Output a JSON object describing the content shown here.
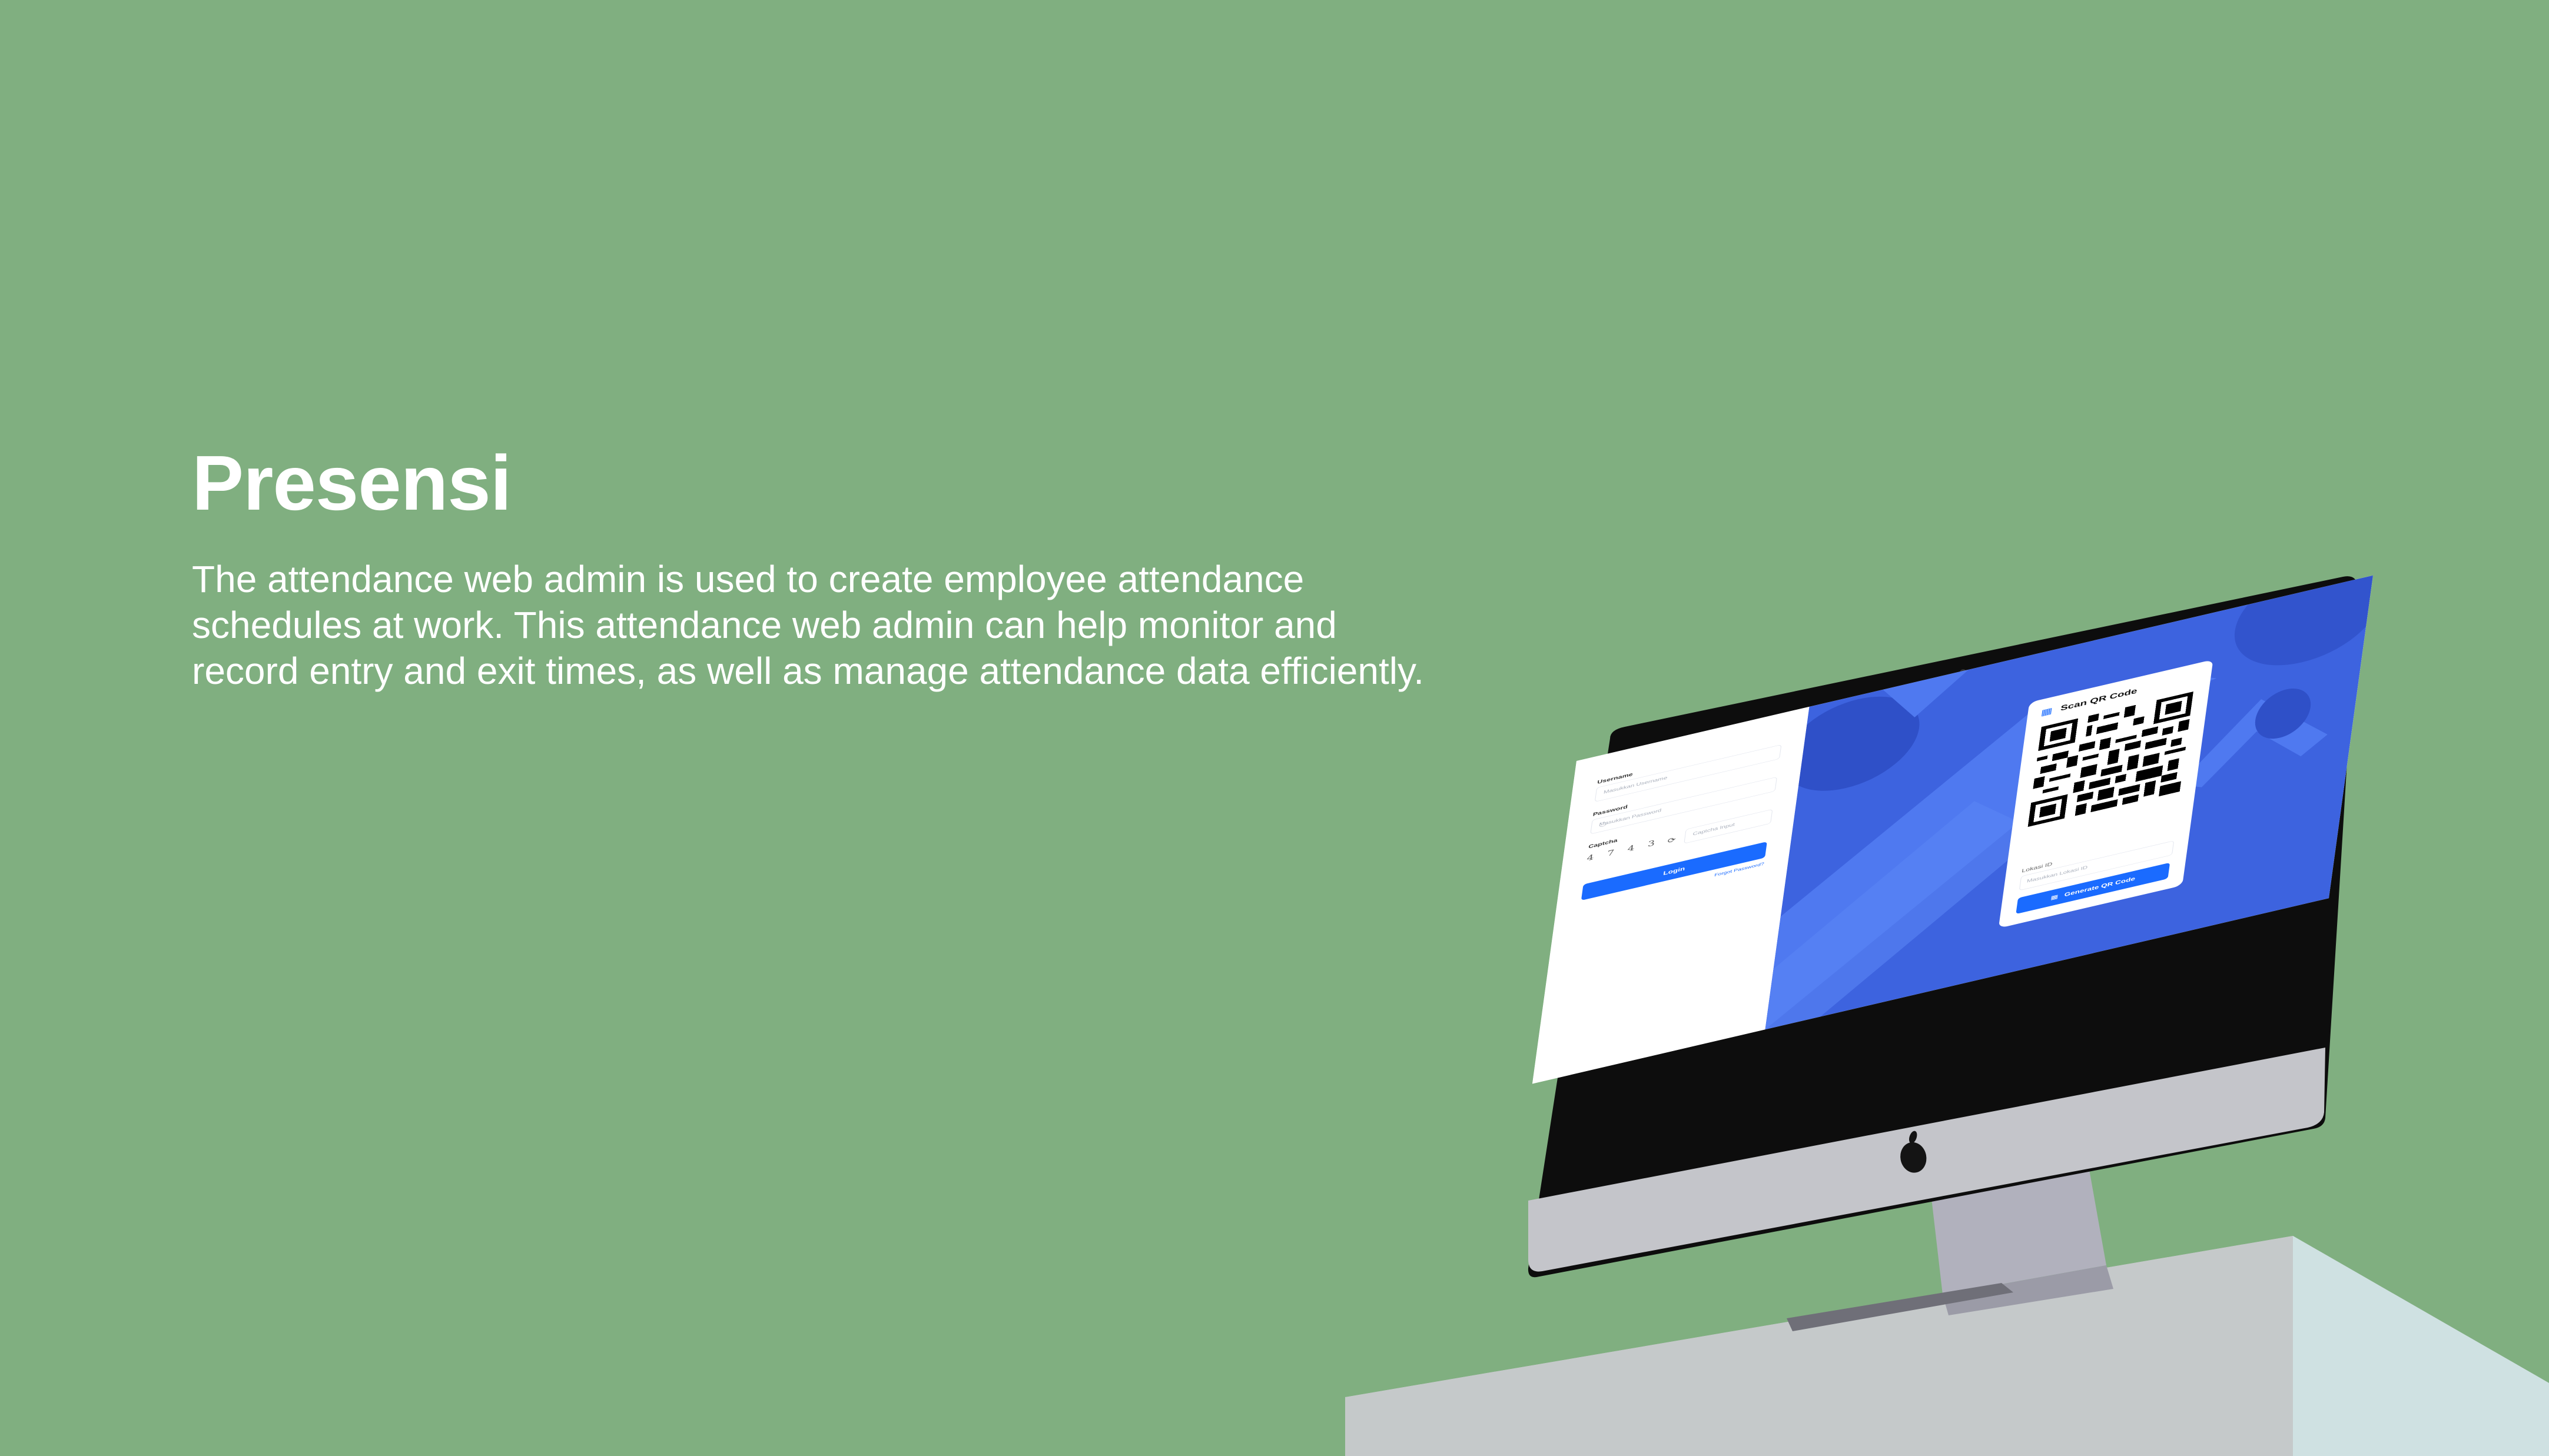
{
  "hero": {
    "title": "Presensi",
    "description": "The attendance web admin is used to create employee attendance schedules at work. This attendance web admin can help monitor and record entry and exit times, as well as manage attendance data efficiently."
  },
  "colors": {
    "background": "#80af80",
    "accent": "#1a6bff",
    "panel_blue": "#3d63df"
  },
  "screen": {
    "login": {
      "username_label": "Username",
      "username_placeholder": "Masukkan Username",
      "password_label": "Password",
      "password_placeholder": "Masukkan Password",
      "captcha_label": "Captcha",
      "captcha_text": "4 7 4 3",
      "captcha_placeholder": "Captcha Input",
      "login_label": "Login",
      "forgot_label": "Forgot Password?"
    },
    "qr": {
      "title": "Scan QR Code",
      "location_label": "Lokasi ID",
      "location_placeholder": "Masukkan Lokasi ID",
      "generate_label": "Generate QR Code"
    }
  }
}
